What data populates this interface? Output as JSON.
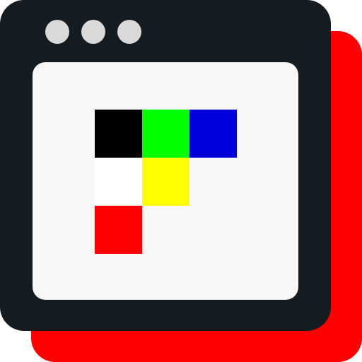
{
  "colors": {
    "shadow_window": "#ff0000",
    "window_frame": "#141b21",
    "title_dots": "#d9d9d9",
    "content_bg": "#f7f7f7"
  },
  "palette": [
    {
      "row": 0,
      "col": 0,
      "color": "#000000"
    },
    {
      "row": 0,
      "col": 1,
      "color": "#00ff00"
    },
    {
      "row": 0,
      "col": 2,
      "color": "#0000dd"
    },
    {
      "row": 1,
      "col": 0,
      "color": "#ffffff"
    },
    {
      "row": 1,
      "col": 1,
      "color": "#ffff00"
    },
    {
      "row": 2,
      "col": 0,
      "color": "#ff0000"
    }
  ]
}
